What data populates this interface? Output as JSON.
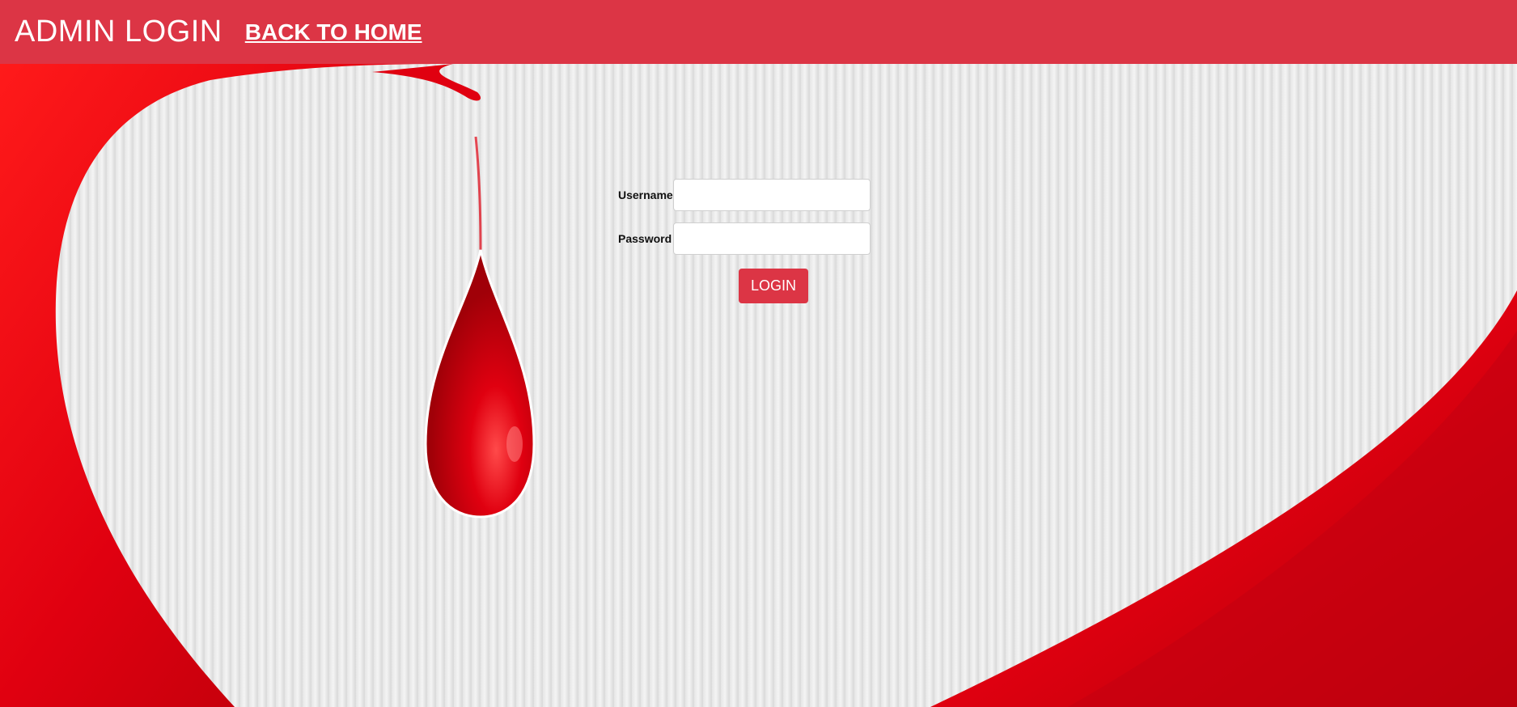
{
  "header": {
    "title": "ADMIN LOGIN",
    "back_link": "BACK TO HOME"
  },
  "form": {
    "username_label": "Username",
    "username_value": "",
    "password_label": "Password",
    "password_value": "",
    "login_label": "LOGIN"
  },
  "colors": {
    "accent": "#dc3545",
    "blood": "#d00010"
  }
}
